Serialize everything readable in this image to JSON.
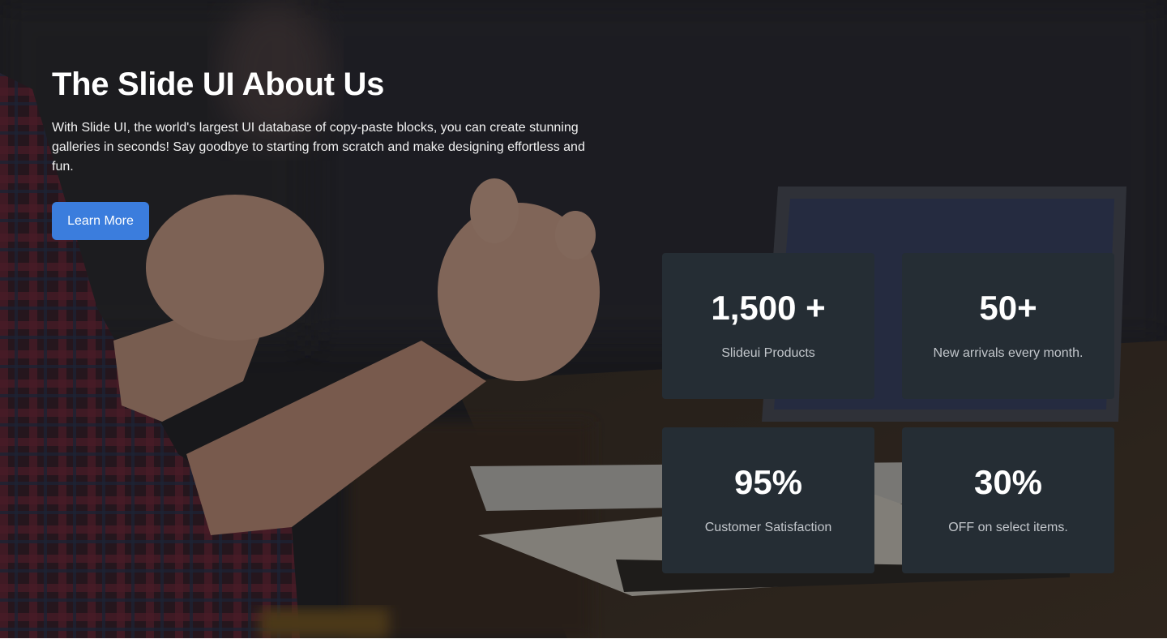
{
  "hero": {
    "title": "The Slide UI About Us",
    "description": "With Slide UI, the world's largest UI database of copy-paste blocks, you can create stunning galleries in seconds! Say goodbye to starting from scratch and make designing effortless and fun.",
    "cta_label": "Learn More"
  },
  "stats": [
    {
      "value": "1,500 +",
      "label": "Slideui Products"
    },
    {
      "value": "50+",
      "label": "New arrivals every month."
    },
    {
      "value": "95%",
      "label": "Customer Satisfaction"
    },
    {
      "value": "30%",
      "label": "OFF on select items."
    }
  ],
  "colors": {
    "accent": "#3b7ddd",
    "card_background": "#252d34",
    "overlay": "#1b1b1e"
  }
}
